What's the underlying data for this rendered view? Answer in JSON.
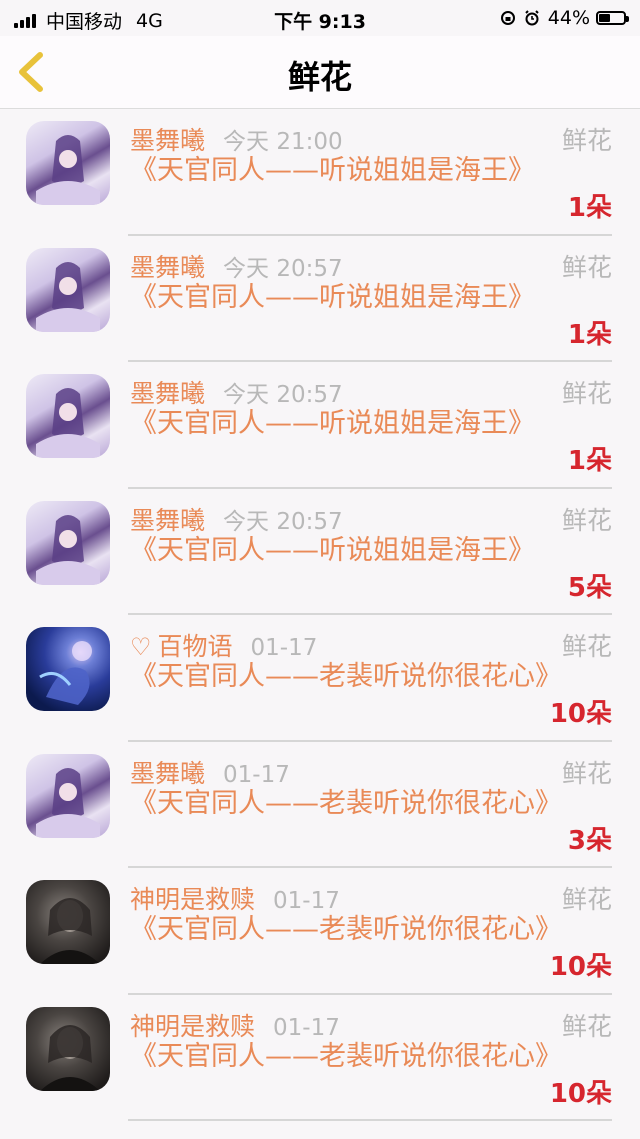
{
  "status_bar": {
    "carrier": "中国移动",
    "network": "4G",
    "time": "下午 9:13",
    "battery_percent": "44%",
    "battery_level": 0.44
  },
  "nav": {
    "title": "鲜花",
    "back_icon": "chevron-left-icon",
    "accent_color": "#e8c23a"
  },
  "items": [
    {
      "name": "墨舞曦",
      "time": "今天 21:00",
      "category": "鲜花",
      "title": "《天官同人——听说姐姐是海王》",
      "count": "1朵",
      "avatar": "anime-girl-purple-avatar",
      "heart": false
    },
    {
      "name": "墨舞曦",
      "time": "今天 20:57",
      "category": "鲜花",
      "title": "《天官同人——听说姐姐是海王》",
      "count": "1朵",
      "avatar": "anime-girl-purple-avatar",
      "heart": false
    },
    {
      "name": "墨舞曦",
      "time": "今天 20:57",
      "category": "鲜花",
      "title": "《天官同人——听说姐姐是海王》",
      "count": "1朵",
      "avatar": "anime-girl-purple-avatar",
      "heart": false
    },
    {
      "name": "墨舞曦",
      "time": "今天 20:57",
      "category": "鲜花",
      "title": "《天官同人——听说姐姐是海王》",
      "count": "5朵",
      "avatar": "anime-girl-purple-avatar",
      "heart": false
    },
    {
      "name": "百物语",
      "time": "01-17",
      "category": "鲜花",
      "title": "《天官同人——老裴听说你很花心》",
      "count": "10朵",
      "avatar": "blue-fantasy-avatar",
      "heart": true
    },
    {
      "name": "墨舞曦",
      "time": "01-17",
      "category": "鲜花",
      "title": "《天官同人——老裴听说你很花心》",
      "count": "3朵",
      "avatar": "anime-girl-purple-avatar",
      "heart": false
    },
    {
      "name": "神明是救赎",
      "time": "01-17",
      "category": "鲜花",
      "title": "《天官同人——老裴听说你很花心》",
      "count": "10朵",
      "avatar": "dark-portrait-avatar",
      "heart": false
    },
    {
      "name": "神明是救赎",
      "time": "01-17",
      "category": "鲜花",
      "title": "《天官同人——老裴听说你很花心》",
      "count": "10朵",
      "avatar": "dark-portrait-avatar",
      "heart": false
    }
  ]
}
